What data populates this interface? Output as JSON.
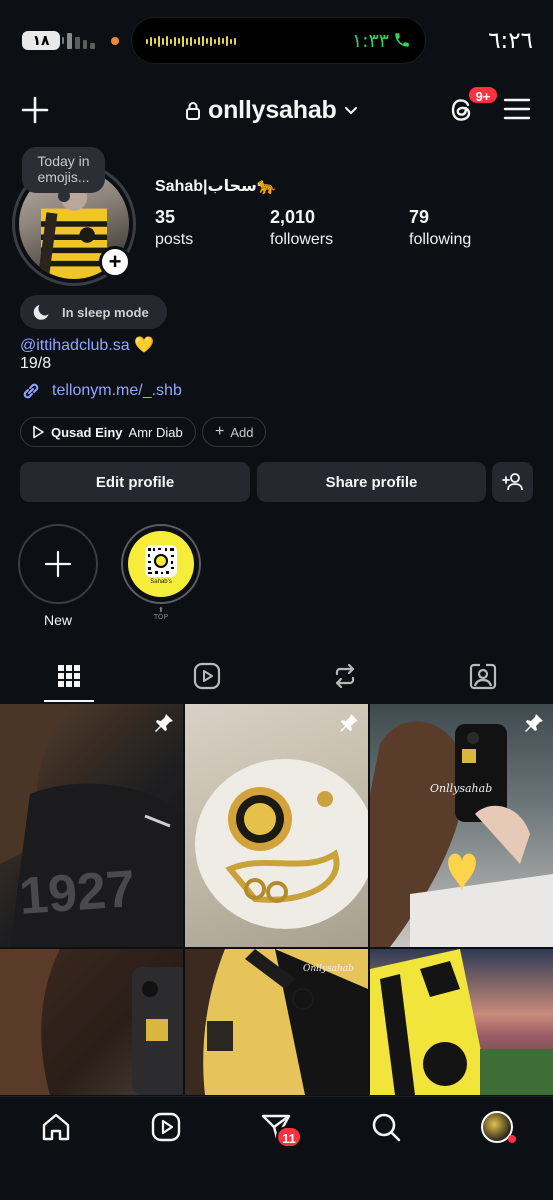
{
  "status_bar": {
    "battery": "١٨",
    "call_timer": "١:٣٣",
    "clock": "٦:٢٦"
  },
  "header": {
    "username": "onllysahab",
    "notification_badge": "9+"
  },
  "profile": {
    "note": "Today in emojis...",
    "display_name": "Sahab|سحاب🐆",
    "stats": {
      "posts_count": "35",
      "posts_label": "posts",
      "followers_count": "2,010",
      "followers_label": "followers",
      "following_count": "79",
      "following_label": "following"
    },
    "sleep_mode": "In sleep mode",
    "bio_link": "@ittihadclub.sa 💛",
    "bio_text": "19/8",
    "website": "tellonym.me/_.shb",
    "music": {
      "song": "Qusad Einy",
      "artist": "Amr Diab"
    },
    "add_label": "Add"
  },
  "actions": {
    "edit_profile": "Edit profile",
    "share_profile": "Share profile"
  },
  "highlights": [
    {
      "label": "New"
    },
    {
      "label": ""
    }
  ],
  "highlight_caption": "Sahab's",
  "highlight_top_tag": "TOP",
  "tabs": [
    "posts",
    "reels",
    "reposts",
    "tagged"
  ],
  "grid": {
    "watermark": "Onllysahab",
    "jersey_number": "1927"
  },
  "bottom_nav": {
    "dm_badge": "11"
  },
  "colors": {
    "background": "#0c0f14",
    "button": "#25282f",
    "link": "#8fa6ff",
    "badge": "#ff3040",
    "call_green": "#33d35a"
  }
}
